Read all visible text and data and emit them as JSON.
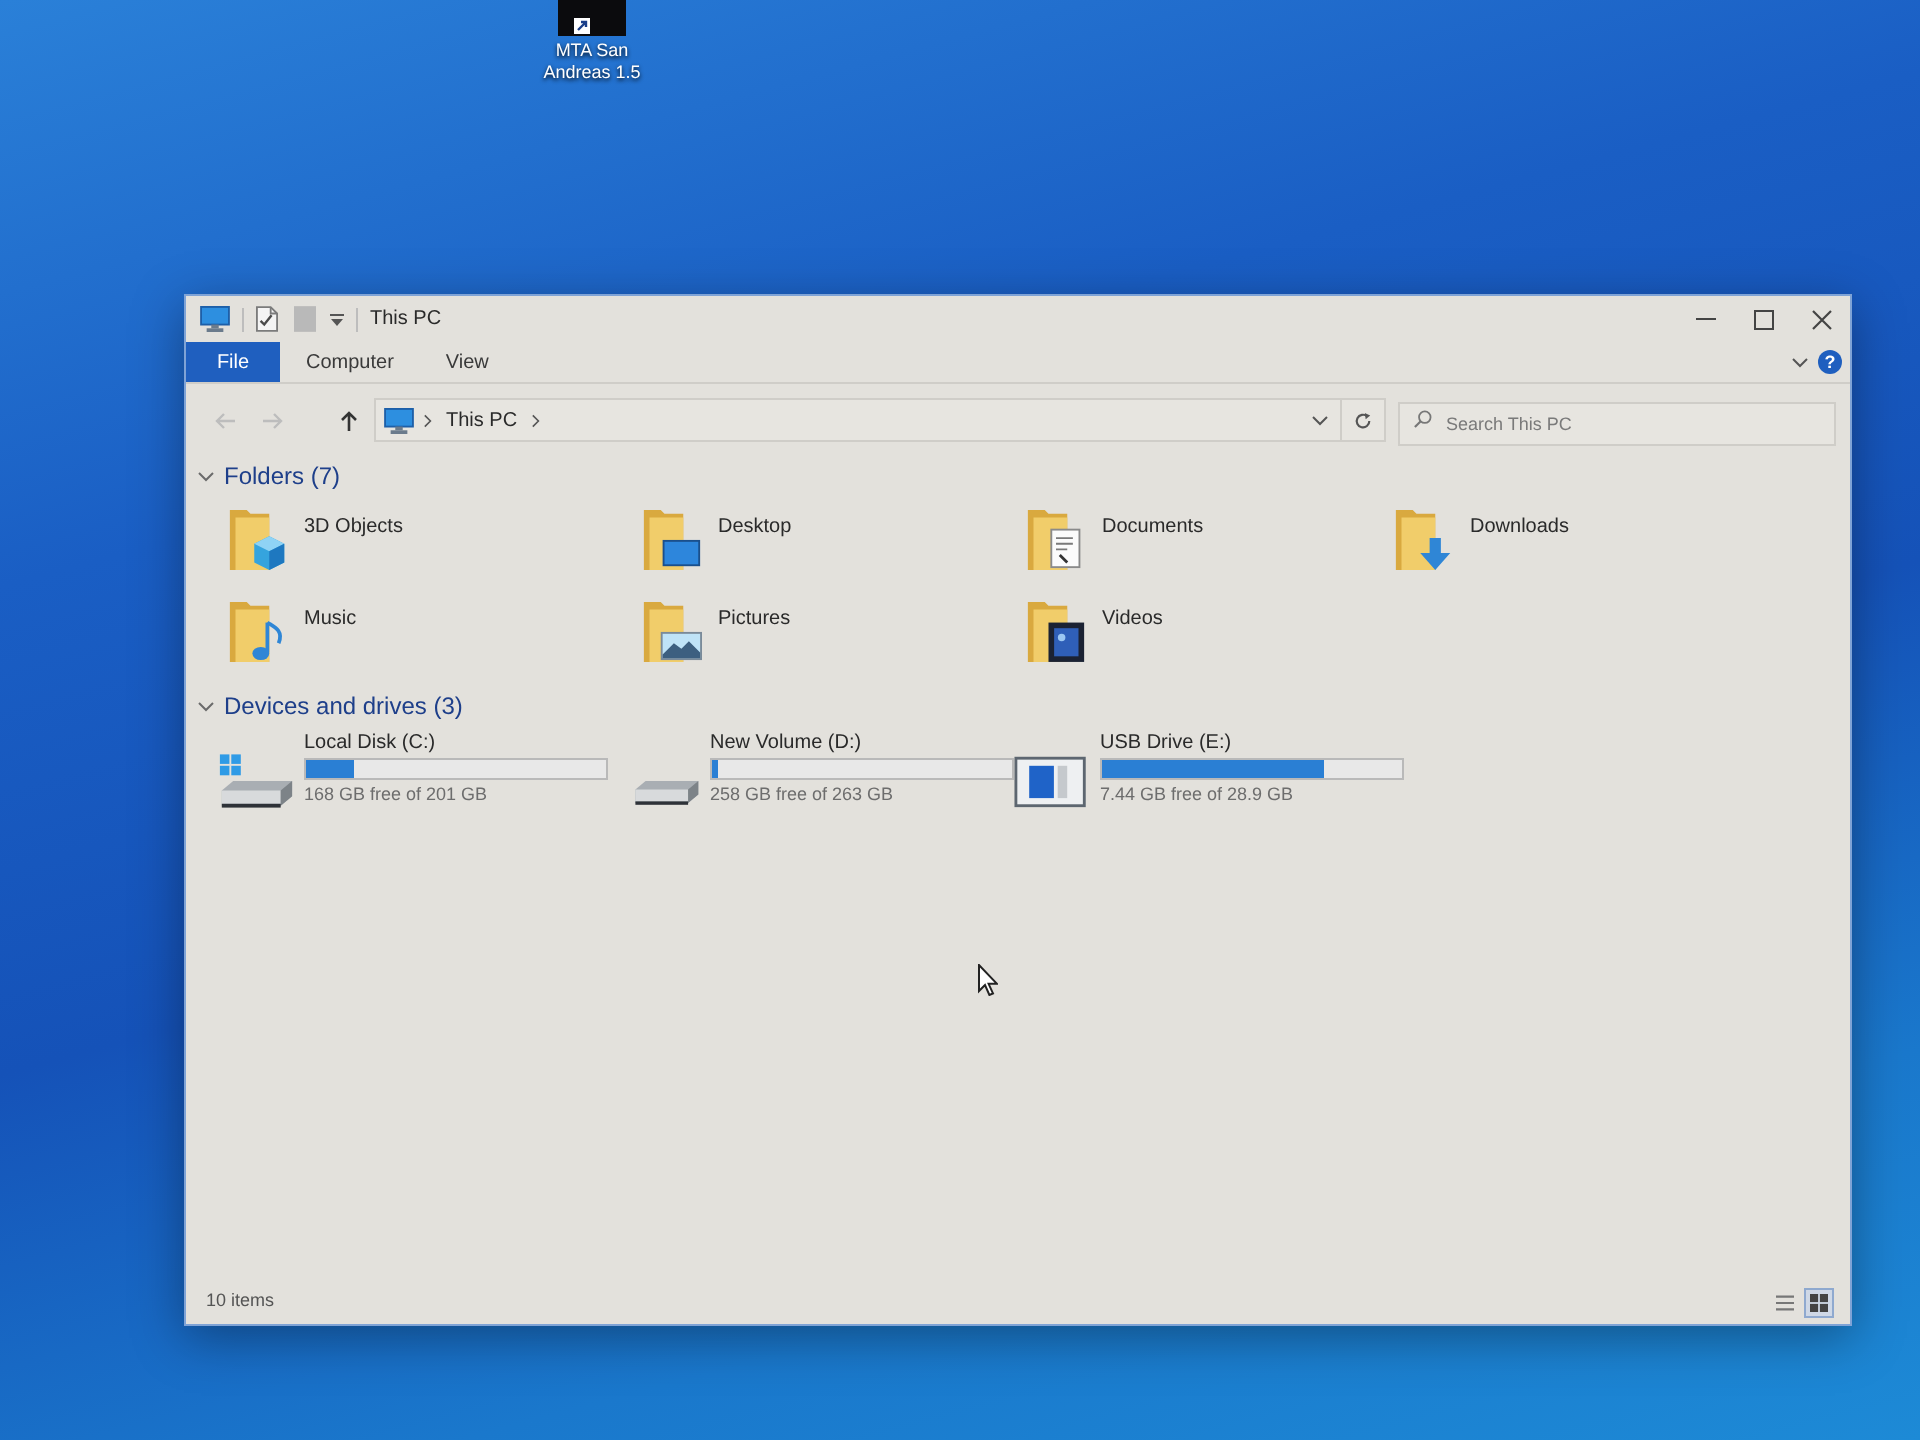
{
  "desktop": {
    "shortcuts": [
      {
        "label": "MTA San Andreas 1.5"
      }
    ]
  },
  "window": {
    "title": "This PC"
  },
  "ribbon": {
    "tabs": [
      {
        "label": "File",
        "selected": true
      },
      {
        "label": "Computer",
        "selected": false
      },
      {
        "label": "View",
        "selected": false
      }
    ],
    "help": "?"
  },
  "navigation": {
    "buttons": [
      {
        "kind": "back",
        "disabled": true
      },
      {
        "kind": "forward",
        "disabled": true
      },
      {
        "kind": "up",
        "disabled": false
      }
    ],
    "path": [
      "This PC"
    ],
    "search": {
      "placeholder": "Search This PC"
    }
  },
  "sections": [
    {
      "kind": "folders",
      "title": "Folders (7)",
      "expanded": true,
      "items": [
        {
          "name": "3D Objects",
          "kind": "objects"
        },
        {
          "name": "Desktop",
          "kind": "desktop"
        },
        {
          "name": "Documents",
          "kind": "documents"
        },
        {
          "name": "Downloads",
          "kind": "downloads"
        },
        {
          "name": "Music",
          "kind": "music"
        },
        {
          "name": "Pictures",
          "kind": "pictures"
        },
        {
          "name": "Videos",
          "kind": "videos"
        }
      ]
    },
    {
      "kind": "drives",
      "title": "Devices and drives (3)",
      "expanded": true,
      "items": [
        {
          "name": "Local Disk (C:)",
          "kind": "system",
          "level": 0.16,
          "reading": "168 GB free of 201 GB"
        },
        {
          "name": "New Volume (D:)",
          "kind": "hdd",
          "level": 0.02,
          "reading": "258 GB free of 263 GB"
        },
        {
          "name": "USB Drive (E:)",
          "kind": "usb",
          "level": 0.74,
          "reading": "7.44 GB free of 28.9 GB"
        }
      ]
    }
  ],
  "status_bar": {
    "count": "10 items",
    "view_buttons": [
      {
        "kind": "details",
        "selected": false
      },
      {
        "kind": "icons",
        "selected": true
      }
    ]
  }
}
